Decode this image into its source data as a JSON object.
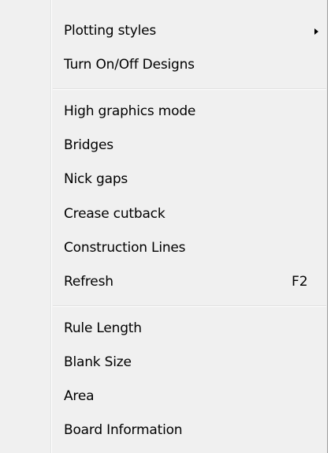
{
  "menu": {
    "items": [
      {
        "label": "Plotting styles",
        "has_submenu": true
      },
      {
        "label": "Turn On/Off Designs"
      },
      {
        "label": "High graphics mode"
      },
      {
        "label": "Bridges"
      },
      {
        "label": "Nick gaps"
      },
      {
        "label": "Crease cutback"
      },
      {
        "label": "Construction Lines"
      },
      {
        "label": "Refresh",
        "shortcut": "F2"
      },
      {
        "label": "Rule Length"
      },
      {
        "label": "Blank Size"
      },
      {
        "label": "Area"
      },
      {
        "label": "Board Information"
      }
    ]
  }
}
